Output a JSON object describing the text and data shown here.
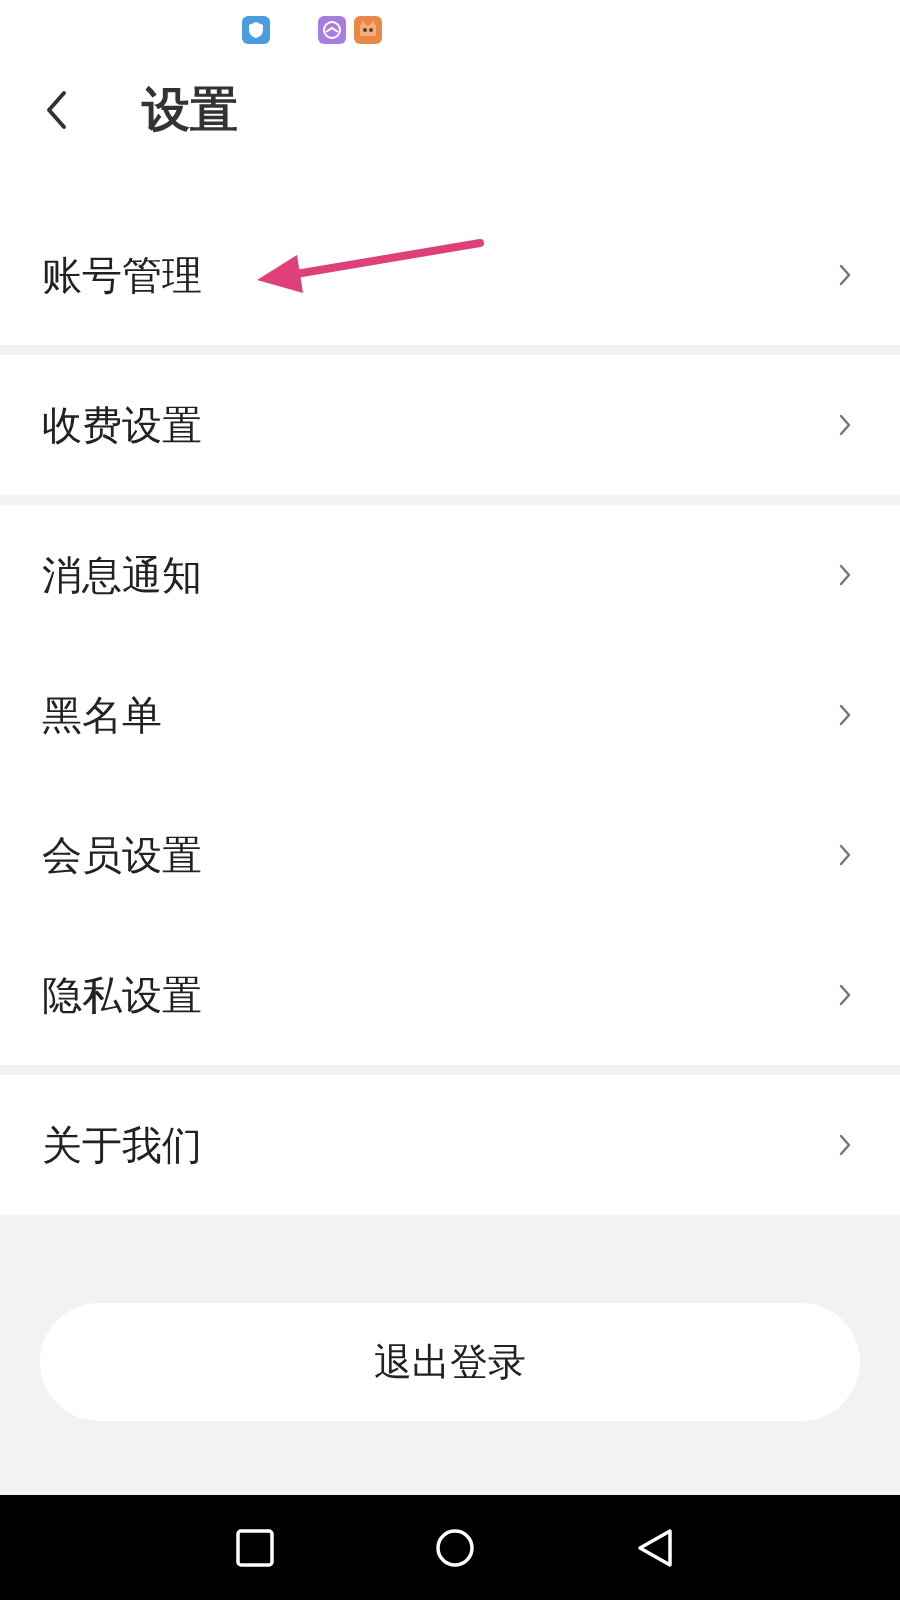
{
  "header": {
    "title": "设置"
  },
  "groups": [
    {
      "items": [
        {
          "label": "账号管理",
          "annotated": true
        }
      ]
    },
    {
      "items": [
        {
          "label": "收费设置",
          "annotated": false
        }
      ]
    },
    {
      "items": [
        {
          "label": "消息通知",
          "annotated": false
        },
        {
          "label": "黑名单",
          "annotated": false
        },
        {
          "label": "会员设置",
          "annotated": false
        },
        {
          "label": "隐私设置",
          "annotated": false
        }
      ]
    },
    {
      "items": [
        {
          "label": "关于我们",
          "annotated": false
        }
      ]
    }
  ],
  "logout_button": {
    "label": "退出登录"
  }
}
